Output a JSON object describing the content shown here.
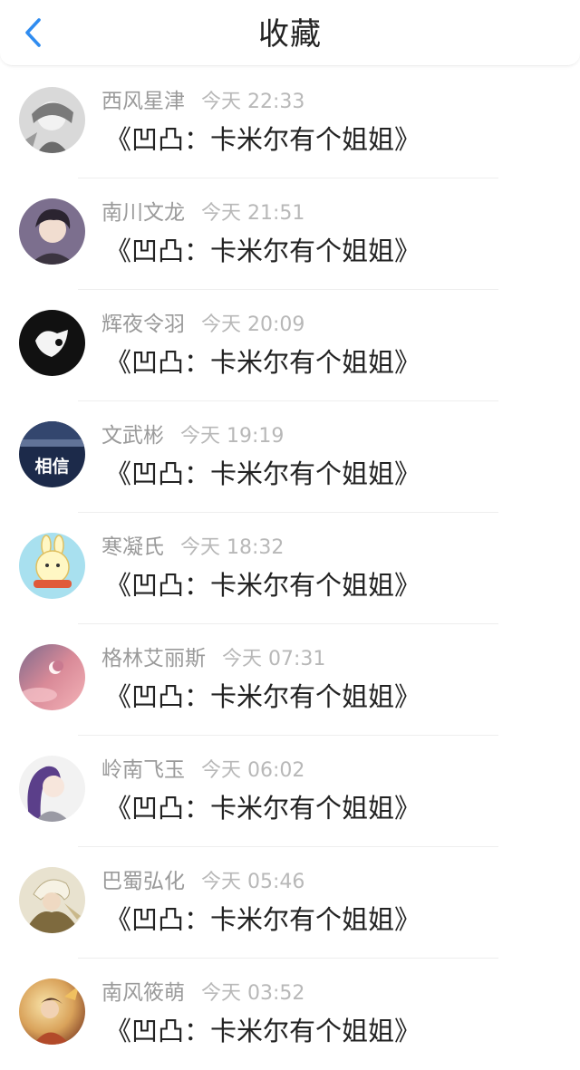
{
  "header": {
    "title": "收藏",
    "back_icon": "chevron-left-icon",
    "accent_color": "#2f8cf0"
  },
  "items": [
    {
      "name": "西风星津",
      "time": "今天 22:33",
      "message": "《凹凸：卡米尔有个姐姐》"
    },
    {
      "name": "南川文龙",
      "time": "今天 21:51",
      "message": "《凹凸：卡米尔有个姐姐》"
    },
    {
      "name": "辉夜令羽",
      "time": "今天 20:09",
      "message": "《凹凸：卡米尔有个姐姐》"
    },
    {
      "name": "文武彬",
      "time": "今天 19:19",
      "message": "《凹凸：卡米尔有个姐姐》",
      "avatar_text": "相信"
    },
    {
      "name": "寒凝氏",
      "time": "今天 18:32",
      "message": "《凹凸：卡米尔有个姐姐》"
    },
    {
      "name": "格林艾丽斯",
      "time": "今天 07:31",
      "message": "《凹凸：卡米尔有个姐姐》"
    },
    {
      "name": "岭南飞玉",
      "time": "今天 06:02",
      "message": "《凹凸：卡米尔有个姐姐》"
    },
    {
      "name": "巴蜀弘化",
      "time": "今天 05:46",
      "message": "《凹凸：卡米尔有个姐姐》"
    },
    {
      "name": "南风筱萌",
      "time": "今天 03:52",
      "message": "《凹凸：卡米尔有个姐姐》"
    }
  ]
}
